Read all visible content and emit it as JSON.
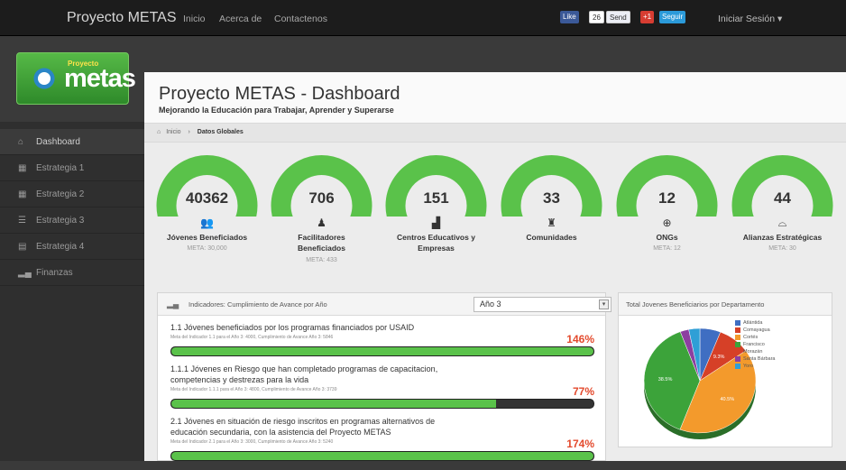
{
  "topbar": {
    "brand": "Proyecto METAS",
    "nav": [
      {
        "label": "Inicio"
      },
      {
        "label": "Acerca de"
      },
      {
        "label": "Contactenos"
      }
    ],
    "social": {
      "like": "Like",
      "like_count": "26",
      "send": "Send",
      "gplus": "+1",
      "twitter": "Seguir"
    },
    "login": "Iniciar Sesión ▾"
  },
  "logo": {
    "small": "Proyecto",
    "text": "metas"
  },
  "sidebar": {
    "items": [
      {
        "label": "Dashboard",
        "icon": "home-icon"
      },
      {
        "label": "Estrategia 1",
        "icon": "grid-icon"
      },
      {
        "label": "Estrategia 2",
        "icon": "grid-icon"
      },
      {
        "label": "Estrategia 3",
        "icon": "list-icon"
      },
      {
        "label": "Estrategia 4",
        "icon": "table-icon"
      },
      {
        "label": "Finanzas",
        "icon": "bar-chart-icon"
      }
    ]
  },
  "header": {
    "title": "Proyecto METAS - Dashboard",
    "subtitle": "Mejorando la Educación para Trabajar, Aprender y Superarse"
  },
  "breadcrumb": {
    "home": "Inicio",
    "sep": "›",
    "current": "Datos Globales"
  },
  "gauges": [
    {
      "value": "40362",
      "icon": "people-icon",
      "glyph": "👥",
      "label": "Jóvenes Beneficiados",
      "meta": "META: 30,000",
      "level": 1.0
    },
    {
      "value": "706",
      "icon": "teacher-icon",
      "glyph": "♟",
      "label": "Facilitadores Beneficiados",
      "meta": "META: 433",
      "level": 1.0
    },
    {
      "value": "151",
      "icon": "building-icon",
      "glyph": "▟",
      "label": "Centros Educativos y Empresas",
      "meta": "",
      "level": 1.0
    },
    {
      "value": "33",
      "icon": "community-icon",
      "glyph": "♜",
      "label": "Comunidades",
      "meta": "",
      "level": 1.0
    },
    {
      "value": "12",
      "icon": "globe-icon",
      "glyph": "⊕",
      "label": "ONGs",
      "meta": "META: 12",
      "level": 1.0
    },
    {
      "value": "44",
      "icon": "handshake-icon",
      "glyph": "⌓",
      "label": "Alianzas Estratégicas",
      "meta": "META: 30",
      "level": 1.0
    }
  ],
  "indicators_panel": {
    "title": "Indicadores: Cumplimiento de Avance por Año",
    "selected_year": "Año 3",
    "items": [
      {
        "title": "1.1 Jóvenes beneficiados por los programas financiados por USAID",
        "meta": "Meta del Indicador 1.1 para el Año 3: 4000, Cumplimiento de Avance Año 3: 5846",
        "pct": "146%",
        "progress": 1.0
      },
      {
        "title": "1.1.1 Jóvenes en Riesgo que han completado programas de capacitacion, competencias y destrezas para la vida",
        "meta": "Meta del Indicador 1.1.1 para el Año 3: 4800, Cumplimiento de Avance Año 3: 3739",
        "pct": "77%",
        "progress": 0.77
      },
      {
        "title": "2.1 Jóvenes en situación de riesgo inscritos en programas alternativos de educación secundaria, con la asistencia del Proyecto METAS",
        "meta": "Meta del Indicador 2.1 para el Año 3: 3000, Cumplimiento de Avance Año 3: 5240",
        "pct": "174%",
        "progress": 1.0
      }
    ]
  },
  "pie_panel": {
    "title": "Total Jovenes Beneficiarios por Departamento",
    "legend": [
      {
        "label": "Atlántida",
        "color": "#3f6ec2"
      },
      {
        "label": "Comayagua",
        "color": "#d64027"
      },
      {
        "label": "Cortés",
        "color": "#f39a2c"
      },
      {
        "label": "Francisco Morazán",
        "color": "#3ca33a"
      },
      {
        "label": "Santa Bárbara",
        "color": "#8c3fa0"
      },
      {
        "label": "Yoro",
        "color": "#2f9fd6"
      }
    ],
    "slice_labels": [
      "9.3%",
      "38.5%",
      "40.5%"
    ]
  },
  "chart_data": {
    "type": "pie",
    "title": "Total Jovenes Beneficiarios por Departamento",
    "categories": [
      "Atlántida",
      "Comayagua",
      "Cortés",
      "Francisco Morazán",
      "Santa Bárbara",
      "Yoro"
    ],
    "values": [
      6.0,
      9.3,
      40.5,
      38.5,
      2.5,
      3.2
    ],
    "colors": [
      "#3f6ec2",
      "#d64027",
      "#f39a2c",
      "#3ca33a",
      "#8c3fa0",
      "#2f9fd6"
    ]
  },
  "colors": {
    "accent_green": "#5ac24a",
    "alert_red": "#e34a2d"
  }
}
